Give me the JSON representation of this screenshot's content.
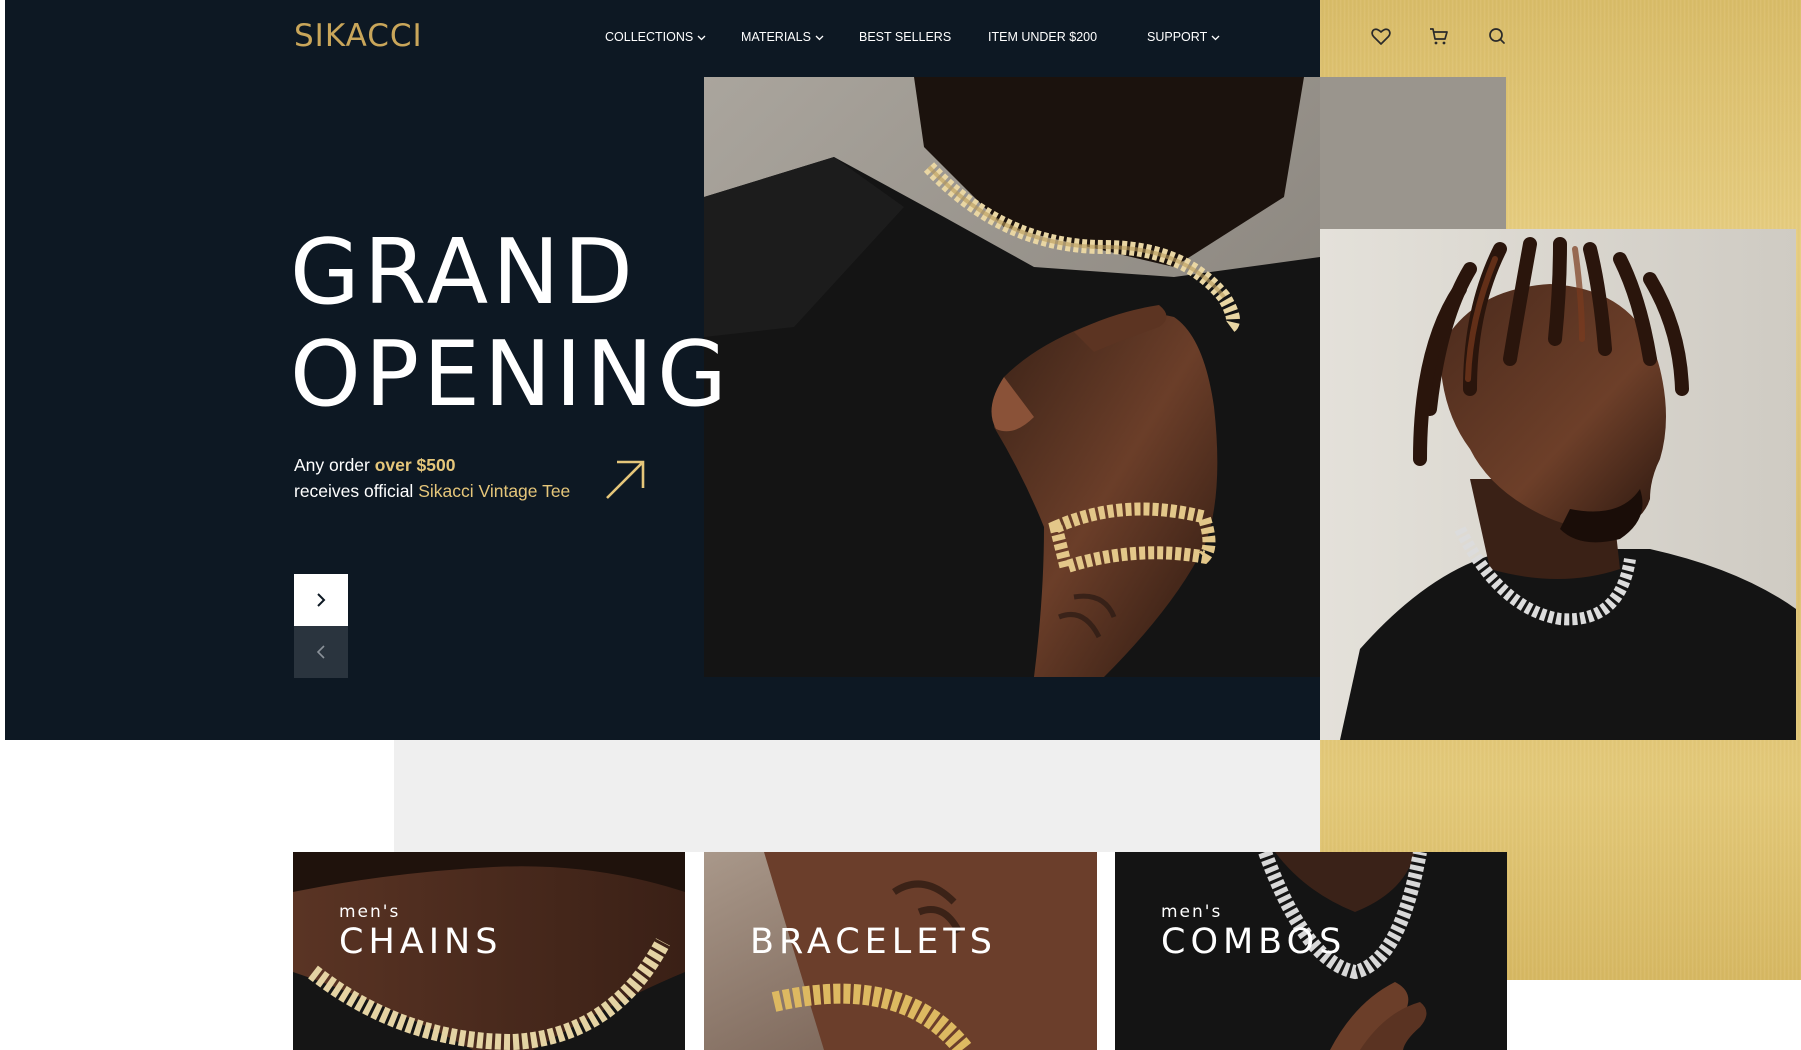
{
  "brand": {
    "logo_text": "SIKACCI",
    "accent": "#c9a65a",
    "dark": "#0d1823"
  },
  "nav": [
    {
      "label": "COLLECTIONS",
      "has_dropdown": true
    },
    {
      "label": "MATERIALS",
      "has_dropdown": true
    },
    {
      "label": "BEST SELLERS",
      "has_dropdown": false
    },
    {
      "label": "ITEM UNDER $200",
      "has_dropdown": false
    },
    {
      "label": "SUPPORT",
      "has_dropdown": true
    }
  ],
  "header_icons": [
    "heart-icon",
    "cart-icon",
    "search-icon"
  ],
  "hero": {
    "headline_line1": "GRAND",
    "headline_line2": "OPENING",
    "promo_prefix": "Any order ",
    "promo_highlight": "over $500",
    "promo_line2_prefix": "receives official ",
    "promo_line2_highlight": "Sikacci Vintage Tee",
    "arrow_icon": "arrow-up-right-icon",
    "next_icon": "chevron-right-icon",
    "prev_icon": "chevron-left-icon"
  },
  "categories": [
    {
      "subtitle": "men's",
      "title": "CHAINS"
    },
    {
      "subtitle": "",
      "title": "BRACELETS"
    },
    {
      "subtitle": "men's",
      "title": "COMBOS"
    }
  ]
}
